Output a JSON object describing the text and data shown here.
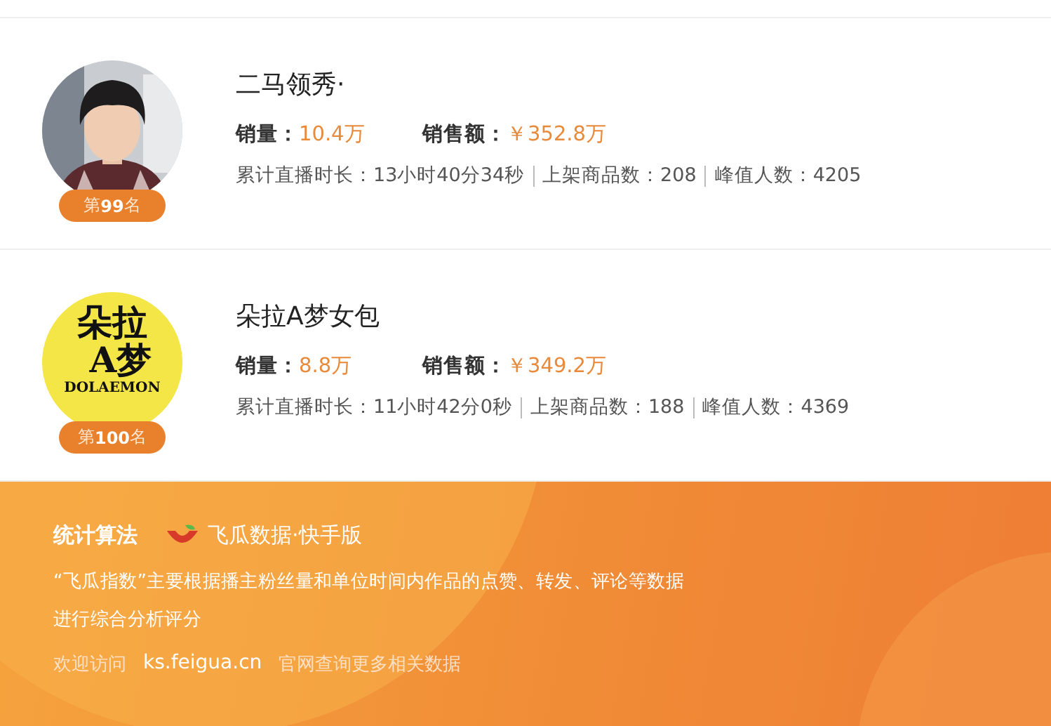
{
  "ranking": [
    {
      "rank_badge": "第**99**名",
      "name": "二马领秀·",
      "sales_label": "销量：",
      "sales": "10.4万",
      "revenue_label": "销售额：",
      "revenue": "￥352.8万",
      "details": [
        "累计直播时长：13小时40分34秒",
        "上架商品数：208",
        "峰值人数：4205"
      ]
    },
    {
      "avatar": {
        "kind": "logo",
        "lines": [
          "朵拉",
          "A梦"
        ],
        "caption": "DOLAEMON"
      },
      "rank_badge": "第**100**名",
      "name": "朵拉A梦女包",
      "sales_label": "销量：",
      "sales": "8.8万",
      "revenue_label": "销售额：",
      "revenue": "￥349.2万",
      "details": [
        "累计直播时长：11小时42分0秒",
        "上架商品数：188",
        "峰值人数：4369"
      ]
    }
  ],
  "footer": {
    "title": "统计算法",
    "brand": "飞瓜数据·快手版",
    "description": "“飞瓜指数”主要根据播主粉丝量和单位时间内作品的点赞、转发、评论等数据进行综合分析评分",
    "visit": "欢迎访问",
    "link": "ks.feigua.cn",
    "visit_suffix": "官网查询更多相关数据"
  }
}
